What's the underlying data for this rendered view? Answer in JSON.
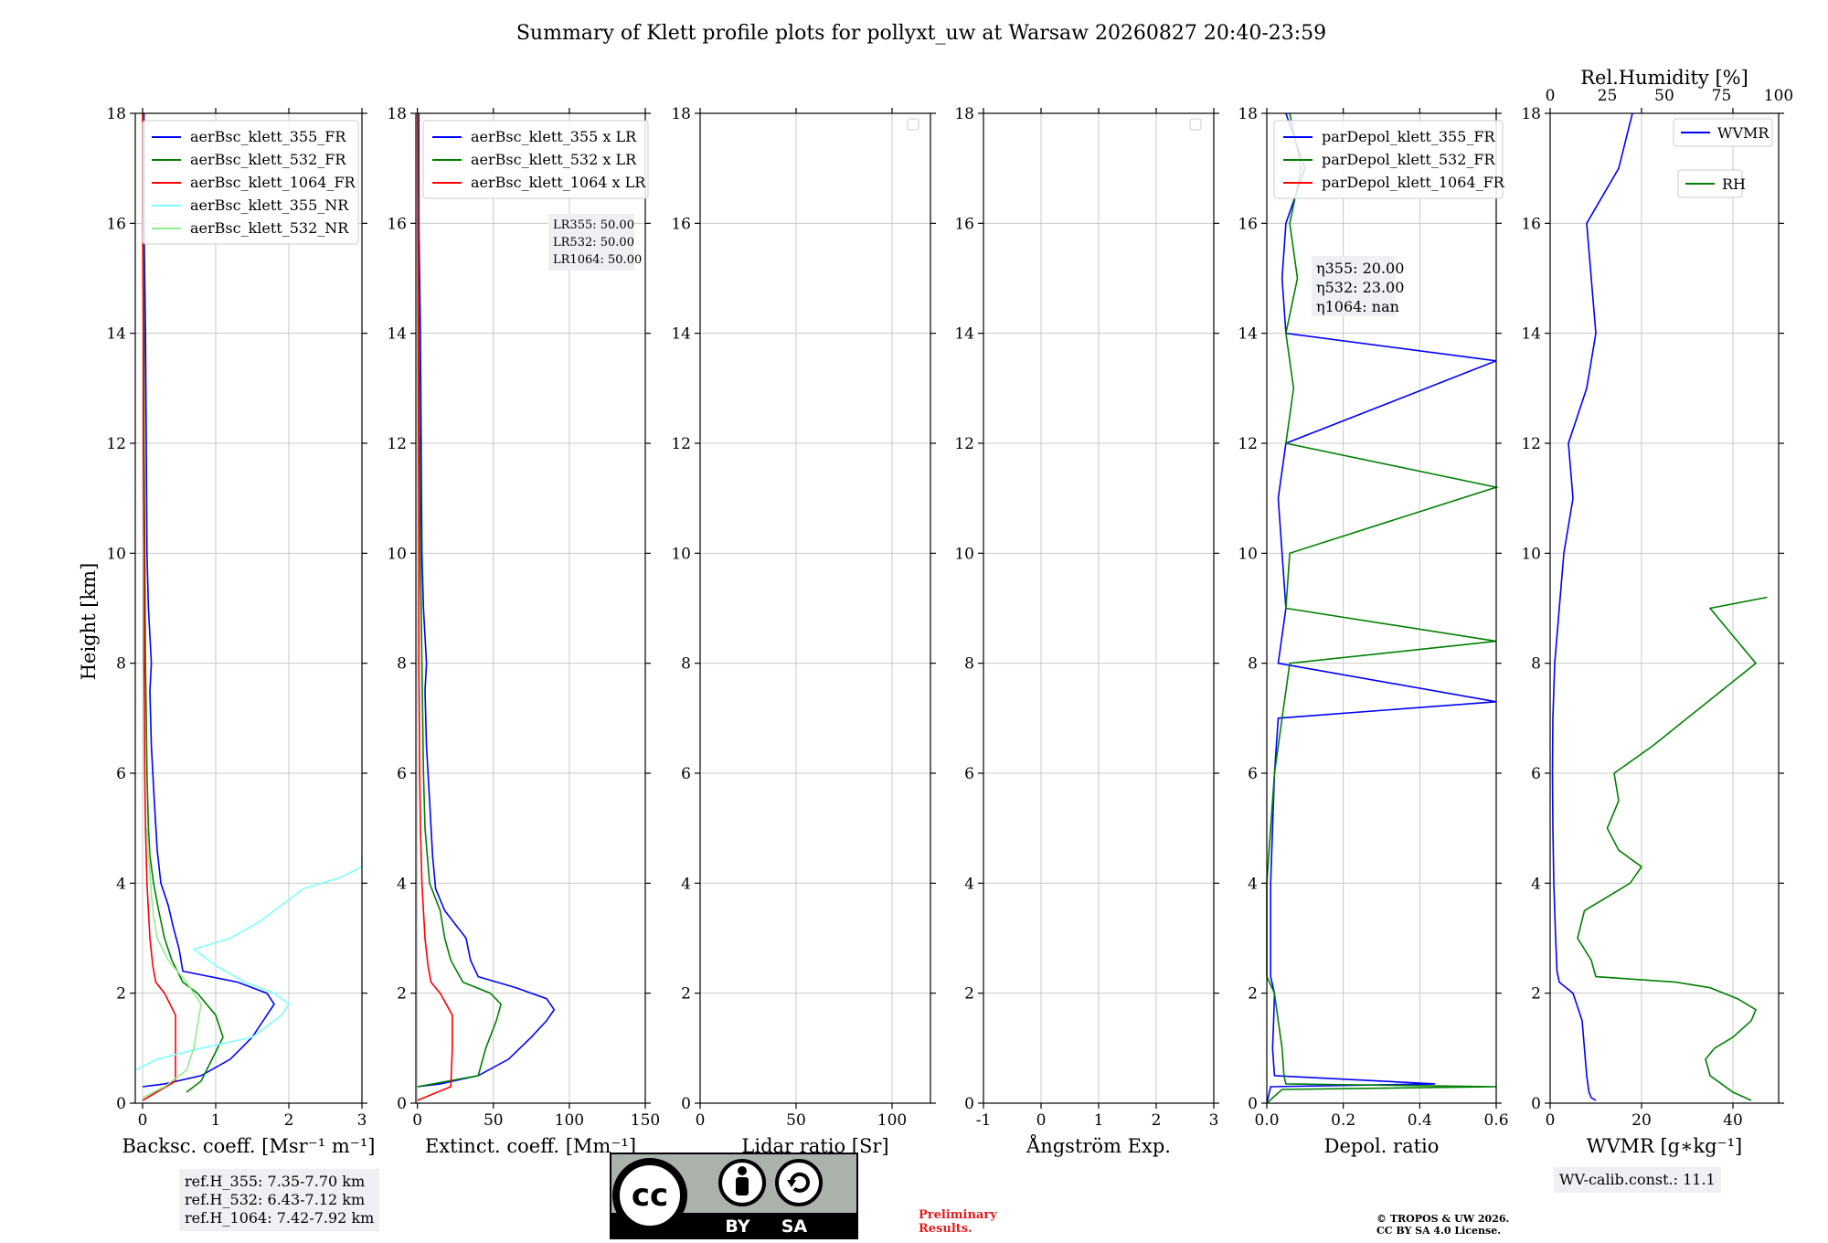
{
  "title": "Summary of Klett profile plots for pollyxt_uw at Warsaw 20260827 20:40-23:59",
  "ylabel": "Height [km]",
  "colors": {
    "b355": "#0000ff",
    "b532": "#008000",
    "b1064": "#ff0000",
    "nr355": "#7fffff",
    "nr532": "#90ee90"
  },
  "chart_data": [
    {
      "type": "line",
      "id": "bsc",
      "xlabel": "Backsc. coeff. [Msr$^{-1}$ m$^{-1}$]",
      "xlabel_display": "Backsc. coeff. [Msr⁻¹ m⁻¹]",
      "xlim": [
        -0.1,
        3
      ],
      "ylim": [
        0,
        18
      ],
      "xticks": [
        0,
        1,
        2,
        3
      ],
      "yticks": [
        0,
        2,
        4,
        6,
        8,
        10,
        12,
        14,
        16,
        18
      ],
      "legend": [
        "aerBsc_klett_355_FR",
        "aerBsc_klett_532_FR",
        "aerBsc_klett_1064_FR",
        "aerBsc_klett_355_NR",
        "aerBsc_klett_532_NR"
      ],
      "series": [
        {
          "name": "aerBsc_klett_355_FR",
          "color": "#0000ff",
          "y": [
            0.3,
            0.35,
            0.5,
            0.8,
            1.2,
            1.6,
            1.8,
            2.0,
            2.2,
            2.4,
            2.8,
            3.2,
            3.6,
            4.0,
            4.6,
            5.5,
            6.5,
            7.5,
            8.0,
            9.0,
            10.0,
            12.0,
            14.0,
            16.0,
            18.0
          ],
          "x": [
            0.0,
            0.3,
            0.8,
            1.2,
            1.5,
            1.7,
            1.8,
            1.7,
            1.3,
            0.55,
            0.5,
            0.42,
            0.35,
            0.25,
            0.2,
            0.16,
            0.12,
            0.1,
            0.12,
            0.08,
            0.06,
            0.05,
            0.04,
            0.02,
            0.02
          ]
        },
        {
          "name": "aerBsc_klett_532_FR",
          "color": "#008000",
          "y": [
            0.2,
            0.4,
            0.8,
            1.2,
            1.6,
            2.0,
            2.2,
            2.6,
            3.0,
            3.5,
            4.0,
            4.5,
            5.0,
            6.0,
            7.0,
            8.0,
            10.0,
            12.0,
            14.0,
            16.0,
            18.0
          ],
          "x": [
            0.6,
            0.8,
            0.95,
            1.1,
            1.0,
            0.75,
            0.55,
            0.4,
            0.3,
            0.22,
            0.15,
            0.1,
            0.08,
            0.06,
            0.05,
            0.04,
            0.03,
            0.02,
            0.02,
            0.01,
            0.01
          ]
        },
        {
          "name": "aerBsc_klett_1064_FR",
          "color": "#ff0000",
          "y": [
            0.05,
            0.4,
            1.0,
            1.6,
            2.0,
            2.2,
            2.5,
            3.0,
            3.5,
            4.0,
            5.0,
            6.0,
            8.0,
            10.0,
            12.0,
            14.0,
            16.0,
            18.0
          ],
          "x": [
            0.0,
            0.45,
            0.45,
            0.45,
            0.3,
            0.18,
            0.14,
            0.1,
            0.08,
            0.06,
            0.04,
            0.03,
            0.02,
            0.02,
            0.01,
            0.01,
            0.0,
            0.0
          ]
        },
        {
          "name": "aerBsc_klett_355_NR",
          "color": "#7fffff",
          "y": [
            0.6,
            0.8,
            1.0,
            1.2,
            1.4,
            1.6,
            1.8,
            2.0,
            2.2,
            2.5,
            2.8,
            3.0,
            3.3,
            3.6,
            3.9,
            4.1,
            4.3,
            4.5
          ],
          "x": [
            -0.1,
            0.2,
            0.8,
            1.5,
            1.7,
            1.9,
            2.0,
            1.8,
            1.4,
            1.0,
            0.7,
            1.2,
            1.6,
            1.9,
            2.2,
            2.7,
            3.0,
            3.0
          ]
        },
        {
          "name": "aerBsc_klett_532_NR",
          "color": "#90ee90",
          "y": [
            0.1,
            0.3,
            0.6,
            1.0,
            1.4,
            1.8,
            2.2,
            2.6,
            3.0,
            3.4,
            3.8,
            4.2,
            4.6,
            5.0
          ],
          "x": [
            0.0,
            0.3,
            0.6,
            0.7,
            0.75,
            0.8,
            0.6,
            0.35,
            0.2,
            0.15,
            0.12,
            0.1,
            0.08,
            0.06
          ]
        }
      ]
    },
    {
      "type": "line",
      "id": "ext",
      "xlabel": "Extinct. coeff. [Mm$^{-1}$]",
      "xlabel_display": "Extinct. coeff. [Mm⁻¹]",
      "xlim": [
        -1,
        150
      ],
      "ylim": [
        0,
        18
      ],
      "xticks": [
        0,
        50,
        100,
        150
      ],
      "yticks": [
        0,
        2,
        4,
        6,
        8,
        10,
        12,
        14,
        16,
        18
      ],
      "legend": [
        "aerBsc_klett_355 x LR",
        "aerBsc_klett_532 x LR",
        "aerBsc_klett_1064 x LR"
      ],
      "annotation": [
        "LR355: 50.00",
        "LR532: 50.00",
        "LR1064: 50.00"
      ],
      "series": [
        {
          "name": "aerBsc_klett_355 x LR",
          "color": "#0000ff",
          "y": [
            0.3,
            0.35,
            0.5,
            0.8,
            1.2,
            1.5,
            1.7,
            1.9,
            2.1,
            2.3,
            2.6,
            3.0,
            3.5,
            3.9,
            4.5,
            5.5,
            6.5,
            7.5,
            8.0,
            9.0,
            10.0,
            12.0,
            14.0,
            16.0,
            18.0
          ],
          "x": [
            0,
            15,
            40,
            60,
            75,
            85,
            90,
            85,
            65,
            40,
            35,
            32,
            18,
            12,
            10,
            8,
            6,
            5,
            6,
            4,
            3,
            2.5,
            2,
            1,
            1
          ]
        },
        {
          "name": "aerBsc_klett_532 x LR",
          "color": "#008000",
          "y": [
            0.3,
            0.5,
            1.0,
            1.5,
            1.8,
            2.0,
            2.2,
            2.6,
            3.0,
            3.5,
            4.0,
            5.0,
            6.0,
            8.0,
            10.0,
            12.0,
            14.0,
            16.0,
            18.0
          ],
          "x": [
            0,
            40,
            45,
            52,
            55,
            48,
            30,
            22,
            18,
            15,
            8,
            5,
            4,
            3,
            2,
            1.5,
            1,
            0.5,
            0.5
          ]
        },
        {
          "name": "aerBsc_klett_1064 x LR",
          "color": "#ff0000",
          "y": [
            0.05,
            0.3,
            1.0,
            1.6,
            2.0,
            2.2,
            2.5,
            3.0,
            3.5,
            4.0,
            5.0,
            6.0,
            8.0,
            10.0,
            14.0,
            18.0
          ],
          "x": [
            0,
            22,
            23,
            23,
            15,
            9,
            7,
            5,
            4,
            3,
            2,
            1.5,
            1,
            1,
            0.5,
            0
          ]
        }
      ]
    },
    {
      "type": "line",
      "id": "lr",
      "xlabel": "Lidar ratio [Sr]",
      "xlim": [
        0,
        120
      ],
      "ylim": [
        0,
        18
      ],
      "xticks": [
        0,
        50,
        100
      ],
      "yticks": [
        0,
        2,
        4,
        6,
        8,
        10,
        12,
        14,
        16,
        18
      ],
      "series": []
    },
    {
      "type": "line",
      "id": "ang",
      "xlabel": "Ångström Exp.",
      "xlim": [
        -1,
        3
      ],
      "ylim": [
        0,
        18
      ],
      "xticks": [
        -1,
        0,
        1,
        2,
        3
      ],
      "yticks": [
        0,
        2,
        4,
        6,
        8,
        10,
        12,
        14,
        16,
        18
      ],
      "series": []
    },
    {
      "type": "line",
      "id": "dep",
      "xlabel": "Depol. ratio",
      "xlim": [
        0,
        0.6
      ],
      "ylim": [
        0,
        18
      ],
      "xticks": [
        0.0,
        0.2,
        0.4,
        0.6
      ],
      "xtick_labels": [
        "0.0",
        "0.2",
        "0.4",
        "0.6"
      ],
      "yticks": [
        0,
        2,
        4,
        6,
        8,
        10,
        12,
        14,
        16,
        18
      ],
      "legend": [
        "parDepol_klett_355_FR",
        "parDepol_klett_532_FR",
        "parDepol_klett_1064_FR"
      ],
      "annotation": [
        "η355: 20.00",
        "η532: 23.00",
        "η1064: nan"
      ],
      "series": [
        {
          "name": "parDepol_klett_355_FR",
          "color": "#0000ff",
          "y": [
            0.0,
            0.3,
            0.35,
            0.5,
            1.0,
            1.5,
            2.0,
            2.3,
            3.0,
            4.0,
            5.0,
            6.0,
            7.0,
            7.3,
            8.0,
            9.0,
            10.0,
            11.0,
            12.0,
            13.5,
            14.0,
            15.0,
            16.0,
            17.0,
            18.0
          ],
          "x": [
            0.0,
            0.01,
            0.44,
            0.02,
            0.015,
            0.018,
            0.02,
            0.01,
            0.01,
            0.01,
            0.015,
            0.02,
            0.03,
            0.6,
            0.03,
            0.05,
            0.04,
            0.03,
            0.05,
            0.6,
            0.05,
            0.04,
            0.05,
            0.1,
            0.05
          ]
        },
        {
          "name": "parDepol_klett_532_FR",
          "color": "#008000",
          "y": [
            0.0,
            0.25,
            0.3,
            0.35,
            0.5,
            1.0,
            1.5,
            2.0,
            2.3,
            4.0,
            6.0,
            7.0,
            8.0,
            8.4,
            9.0,
            10.0,
            11.2,
            12.0,
            13.0,
            14.0,
            15.0,
            16.0,
            17.0,
            18.0
          ],
          "x": [
            0.0,
            0.04,
            0.6,
            0.05,
            0.045,
            0.04,
            0.03,
            0.02,
            0.0,
            0.0,
            0.02,
            0.04,
            0.06,
            0.6,
            0.05,
            0.06,
            0.6,
            0.05,
            0.07,
            0.05,
            0.08,
            0.06,
            0.09,
            0.06
          ]
        }
      ]
    },
    {
      "type": "line",
      "id": "wv",
      "xlabel": "WVMR [$g*kg^{-1}$]",
      "xlabel_display": "WVMR [g∗kg⁻¹]",
      "xlim": [
        0,
        50
      ],
      "ylim": [
        0,
        18
      ],
      "xticks": [
        0,
        20,
        40
      ],
      "yticks": [
        0,
        2,
        4,
        6,
        8,
        10,
        12,
        14,
        16,
        18
      ],
      "secondary_xlabel": "Rel.Humidity [%]",
      "secondary_xlim": [
        0,
        100
      ],
      "secondary_xticks": [
        0,
        25,
        50,
        75,
        100
      ],
      "legend": [
        "WVMR",
        "RH"
      ],
      "series": [
        {
          "name": "WVMR",
          "color": "#0000ff",
          "y": [
            0.05,
            0.1,
            0.2,
            0.5,
            1.0,
            1.5,
            2.0,
            2.2,
            2.4,
            3.0,
            4.0,
            5.0,
            6.0,
            7.0,
            8.0,
            9.0,
            10.0,
            11.0,
            12.0,
            13.0,
            14.0,
            15.0,
            16.0,
            17.0,
            18.0
          ],
          "x": [
            10,
            9,
            8.5,
            8,
            7.5,
            7,
            5,
            2,
            1.5,
            1.2,
            0.8,
            0.6,
            0.5,
            0.6,
            1,
            2,
            3,
            5,
            4,
            8,
            10,
            9,
            8,
            15,
            18
          ]
        },
        {
          "name": "RH",
          "color": "#008000",
          "rh": true,
          "y": [
            0.05,
            0.2,
            0.5,
            0.8,
            1.0,
            1.2,
            1.5,
            1.7,
            1.9,
            2.1,
            2.2,
            2.3,
            2.6,
            3.0,
            3.5,
            4.0,
            4.3,
            4.6,
            5.0,
            5.5,
            6.0,
            6.5,
            7.0,
            7.5,
            8.0,
            8.5,
            9.0,
            9.2
          ],
          "x": [
            88,
            80,
            70,
            68,
            72,
            80,
            88,
            90,
            82,
            70,
            55,
            20,
            18,
            12,
            15,
            35,
            40,
            30,
            25,
            30,
            28,
            45,
            60,
            75,
            90,
            80,
            70,
            95
          ]
        }
      ]
    }
  ],
  "annotations": {
    "refh": [
      "ref.H_355: 7.35-7.70 km",
      "ref.H_532: 6.43-7.12 km",
      "ref.H_1064: 7.42-7.92 km"
    ],
    "wv_calib": "WV-calib.const.: 11.1",
    "preliminary": [
      "Preliminary",
      "Results."
    ],
    "copyright": [
      "© TROPOS & UW 2026.",
      "CC BY SA 4.0 License."
    ],
    "cc_badge": [
      "BY",
      "SA"
    ]
  }
}
